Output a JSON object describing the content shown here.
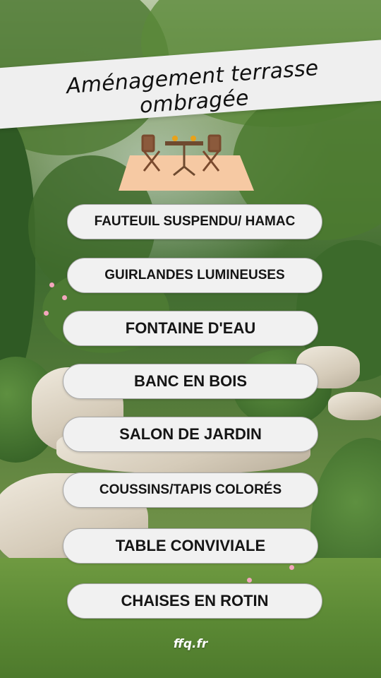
{
  "title": "Aménagement terrasse ombragée",
  "illustration": "terrace-table-icon",
  "items": [
    "FAUTEUIL SUSPENDU/ HAMAC",
    "GUIRLANDES LUMINEUSES",
    "FONTAINE D'EAU",
    "BANC EN BOIS",
    "SALON DE JARDIN",
    "COUSSINS/TAPIS COLORÉS",
    "TABLE CONVIVIALE",
    "CHAISES EN ROTIN"
  ],
  "footer": {
    "brand": "ffq.fr"
  },
  "colors": {
    "banner": "#efefef",
    "pill": "#f1f1f1",
    "pill_border": "#a9a9a9",
    "table": "#f6c9a3"
  }
}
